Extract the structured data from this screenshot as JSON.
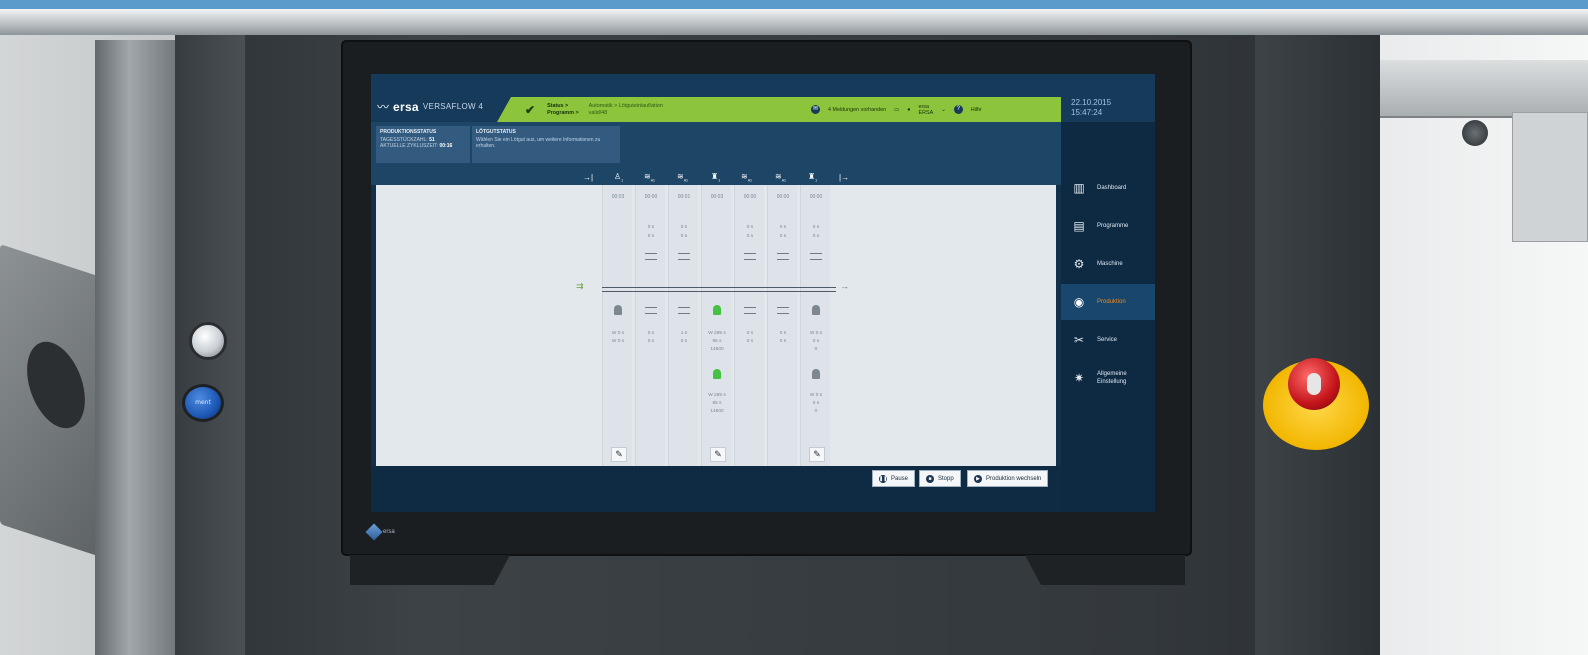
{
  "hmi": {
    "brand": {
      "logo": "ersa",
      "model": "VERSAFLOW 4"
    },
    "status": {
      "label": "Status >",
      "program_label": "Programm >",
      "status_value": "Automatik > Lötguteinlauf/ation",
      "program_value": "valid/48"
    },
    "header_right": {
      "messages": "4 Meldungen vorhanden",
      "user_role": "ersa",
      "user_name": "ERSA",
      "help": "Hilfe"
    },
    "datetime": {
      "date": "22.10.2015",
      "time": "15:47:24"
    },
    "production_status": {
      "title": "PRODUKTIONSSTATUS",
      "line1_label": "TAGESSTÜCKZAHL:",
      "line1_value": "51",
      "line2_label": "AKTUELLE ZYKLUSZEIT:",
      "line2_value": "00:16"
    },
    "solder_status": {
      "title": "LÖTGUTSTATUS",
      "text": "Wählen Sie ein Lötgut aus, um weitere Informationen zu erhalten."
    },
    "toolbar": {
      "enter": "→|",
      "exit": "|→",
      "module_labels": [
        "1",
        "A1",
        "A1",
        "1",
        "A1",
        "A1",
        "1"
      ]
    },
    "columns": [
      {
        "time": "00:03",
        "v1": "",
        "v2": "",
        "b1": "W  0 s",
        "b2": "W  0 s",
        "b3": "",
        "extra": ""
      },
      {
        "time": "00:00",
        "v1": "0 s",
        "v2": "0 s",
        "b1": "0 s",
        "b2": "0 s",
        "b3": "",
        "extra": ""
      },
      {
        "time": "00:01",
        "v1": "0 s",
        "v2": "0 s",
        "b1": "1 s",
        "b2": "0 s",
        "b3": "",
        "extra": ""
      },
      {
        "time": "00:03",
        "v1": "",
        "v2": "",
        "b1": "W 285 s",
        "b2": "85 s",
        "b3": "14500",
        "extra": "W 285 s · 35 s · 14500"
      },
      {
        "time": "00:00",
        "v1": "0 s",
        "v2": "0 s",
        "b1": "0 s",
        "b2": "0 s",
        "b3": "",
        "extra": ""
      },
      {
        "time": "00:00",
        "v1": "0 s",
        "v2": "0 s",
        "b1": "0 s",
        "b2": "0 s",
        "b3": "",
        "extra": ""
      },
      {
        "time": "00:00",
        "v1": "0 s",
        "v2": "0 s",
        "b1": "W  0 s",
        "b2": "0 s",
        "b3": "0",
        "extra": "W 0 s · 0 s · 0"
      }
    ],
    "footer_buttons": {
      "pause": "Pause",
      "stop": "Stopp",
      "change": "Produktion wechseln"
    },
    "nav": [
      {
        "label": "Dashboard",
        "icon": "bar-chart-icon"
      },
      {
        "label": "Programme",
        "icon": "programs-icon"
      },
      {
        "label": "Maschine",
        "icon": "gears-icon"
      },
      {
        "label": "Produktion",
        "icon": "production-icon"
      },
      {
        "label": "Service",
        "icon": "wrench-icon"
      },
      {
        "label": "Allgemeine Einstellung",
        "icon": "settings-icon"
      }
    ],
    "active_nav": "Produktion",
    "colors": {
      "accent_green": "#8cc43b",
      "active_orange": "#f08a1c",
      "lamp_on": "#44c244",
      "nav_bg": "#0e2a43"
    }
  },
  "machine": {
    "blue_button_text": "ment",
    "bezel_logo": "ersa"
  }
}
